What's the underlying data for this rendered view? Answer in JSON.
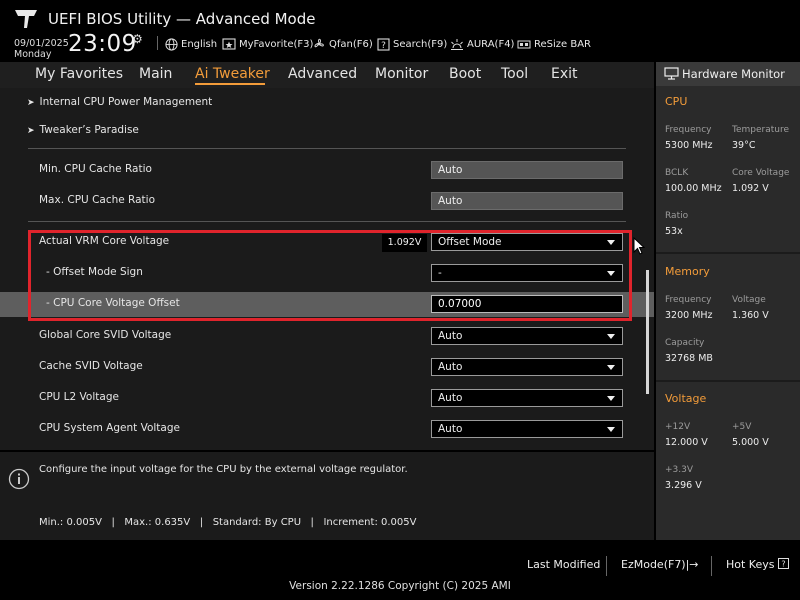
{
  "header": {
    "title": "UEFI BIOS Utility — Advanced Mode",
    "date": "09/01/2025",
    "day": "Monday",
    "time": "23:09",
    "buttons": {
      "language": "English",
      "myfavorite": "MyFavorite(F3)",
      "qfan": "Qfan(F6)",
      "search": "Search(F9)",
      "aura": "AURA(F4)",
      "resizebar": "ReSize BAR"
    }
  },
  "menu": {
    "tabs": [
      "My Favorites",
      "Main",
      "Ai Tweaker",
      "Advanced",
      "Monitor",
      "Boot",
      "Tool",
      "Exit"
    ],
    "active": "Ai Tweaker"
  },
  "content": {
    "submenus": [
      "Internal CPU Power Management",
      "Tweaker’s Paradise"
    ],
    "settings": [
      {
        "label": "Min. CPU Cache Ratio",
        "value": "Auto"
      },
      {
        "label": "Max. CPU Cache Ratio",
        "value": "Auto"
      },
      {
        "label": "Actual VRM Core Voltage",
        "value": "Offset Mode",
        "badge": "1.092V"
      },
      {
        "label": "- Offset Mode Sign",
        "value": "-"
      },
      {
        "label": "- CPU Core Voltage Offset",
        "value": "0.07000"
      },
      {
        "label": "Global Core SVID Voltage",
        "value": "Auto"
      },
      {
        "label": "Cache SVID Voltage",
        "value": "Auto"
      },
      {
        "label": "CPU L2 Voltage",
        "value": "Auto"
      },
      {
        "label": "CPU System Agent Voltage",
        "value": "Auto"
      }
    ]
  },
  "help": {
    "description": "Configure the input voltage for the CPU by the external voltage regulator.",
    "limits": "Min.: 0.005V   |   Max.: 0.635V   |   Standard: By CPU   |   Increment: 0.005V"
  },
  "hardware_monitor": {
    "title": "Hardware Monitor",
    "cpu": {
      "heading": "CPU",
      "frequency_label": "Frequency",
      "frequency": "5300 MHz",
      "temperature_label": "Temperature",
      "temperature": "39°C",
      "bclk_label": "BCLK",
      "bclk": "100.00 MHz",
      "core_voltage_label": "Core Voltage",
      "core_voltage": "1.092 V",
      "ratio_label": "Ratio",
      "ratio": "53x"
    },
    "memory": {
      "heading": "Memory",
      "frequency_label": "Frequency",
      "frequency": "3200 MHz",
      "voltage_label": "Voltage",
      "voltage": "1.360 V",
      "capacity_label": "Capacity",
      "capacity": "32768 MB"
    },
    "voltage": {
      "heading": "Voltage",
      "v12_label": "+12V",
      "v12": "12.000 V",
      "v5_label": "+5V",
      "v5": "5.000 V",
      "v33_label": "+3.3V",
      "v33": "3.296 V"
    }
  },
  "footer": {
    "last_modified": "Last Modified",
    "ezmode": "EzMode(F7)|→",
    "hotkeys": "Hot Keys",
    "version": "Version 2.22.1286 Copyright (C) 2025 AMI"
  },
  "colors": {
    "accent": "#f39c3a",
    "highlight_box": "#e0242c"
  }
}
